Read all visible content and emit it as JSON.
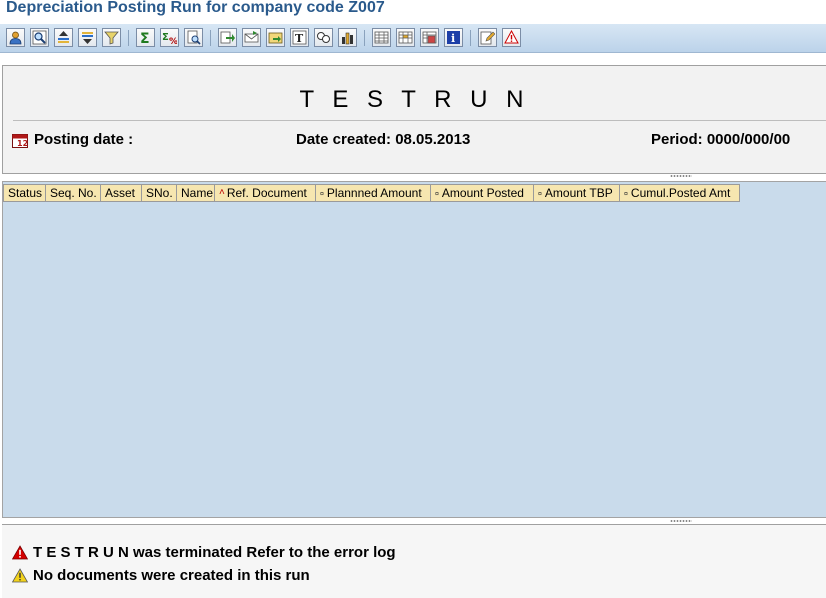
{
  "window": {
    "title": "Depreciation Posting Run for company code Z007"
  },
  "toolbar": {
    "buttons": [
      {
        "icon": "detail-icon"
      },
      {
        "icon": "find-icon"
      },
      {
        "icon": "sort-ascending-icon"
      },
      {
        "icon": "sort-descending-icon"
      },
      {
        "icon": "filter-icon"
      },
      {
        "icon": "total-icon"
      },
      {
        "icon": "subtotal-icon"
      },
      {
        "icon": "print-preview-icon"
      },
      {
        "icon": "export-icon"
      },
      {
        "icon": "mail-icon"
      },
      {
        "icon": "local-file-icon"
      },
      {
        "icon": "word-processing-icon"
      },
      {
        "icon": "abc-analysis-icon"
      },
      {
        "icon": "graphic-icon"
      },
      {
        "icon": "change-layout-icon"
      },
      {
        "icon": "select-layout-icon"
      },
      {
        "icon": "save-layout-icon"
      },
      {
        "icon": "information-icon"
      },
      {
        "icon": "edit-comment-icon"
      },
      {
        "icon": "error-log-icon"
      }
    ]
  },
  "header": {
    "run_title": "T E S T R U N",
    "posting_date_label": "Posting date :",
    "date_created_label": "Date created: 08.05.2013",
    "period_label": "Period: 0000/000/00"
  },
  "grid": {
    "columns": [
      {
        "label": "Status",
        "marker": ""
      },
      {
        "label": "Seq. No.",
        "marker": ""
      },
      {
        "label": "Asset",
        "marker": ""
      },
      {
        "label": "SNo.",
        "marker": ""
      },
      {
        "label": "Name",
        "marker": ""
      },
      {
        "label": "Ref. Document",
        "marker": "sort-up"
      },
      {
        "label": "Plannned Amount",
        "marker": "total"
      },
      {
        "label": "Amount Posted",
        "marker": "total"
      },
      {
        "label": "Amount TBP",
        "marker": "total"
      },
      {
        "label": "Cumul.Posted Amt",
        "marker": "total"
      }
    ]
  },
  "messages": [
    {
      "type": "error",
      "icon": "error-icon",
      "text": "T E S T R U N was terminated Refer to the error log"
    },
    {
      "type": "warning",
      "icon": "warning-icon",
      "text": "No documents were created in this run"
    }
  ],
  "colors": {
    "accent": "#2a5a8c",
    "grid_bg": "#c9dbeb",
    "column_header": "#f6e6b0",
    "error": "#d40000",
    "warning": "#f2d21b"
  }
}
